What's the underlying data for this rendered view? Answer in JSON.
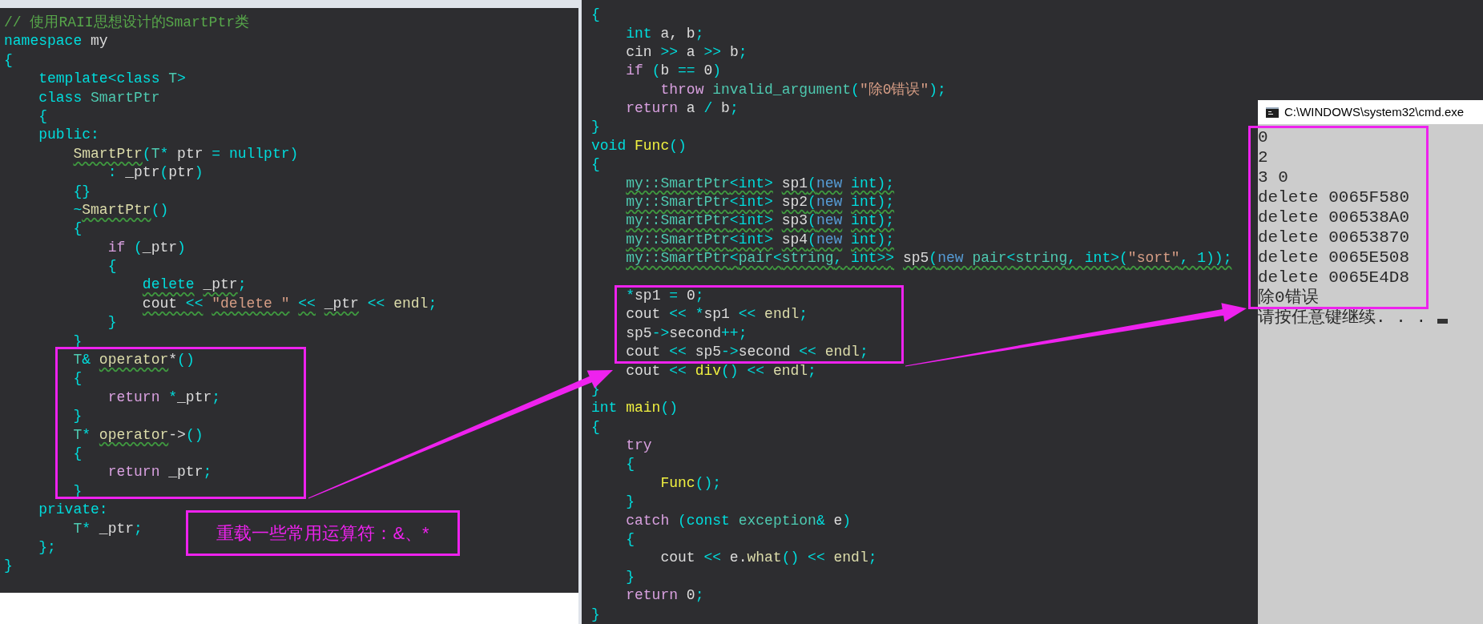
{
  "editors": [
    {
      "lines": [
        {
          "segments": [
            {
              "kind": "comment",
              "text": "// 使用RAII思想设计的SmartPtr类"
            }
          ]
        },
        {
          "segments": [
            {
              "kind": "keyword",
              "text": "namespace"
            },
            {
              "kind": "plain",
              "text": " my"
            }
          ]
        },
        {
          "segments": [
            {
              "kind": "keyword",
              "text": "{"
            }
          ]
        },
        {
          "segments": [
            {
              "kind": "keyword",
              "text": "    template<class "
            },
            {
              "kind": "type",
              "text": "T"
            },
            {
              "kind": "keyword",
              "text": ">"
            }
          ]
        },
        {
          "segments": [
            {
              "kind": "keyword",
              "text": "    class "
            },
            {
              "kind": "type",
              "text": "SmartPtr"
            }
          ]
        },
        {
          "segments": [
            {
              "kind": "keyword",
              "text": "    {"
            }
          ]
        },
        {
          "segments": [
            {
              "kind": "keyword",
              "text": "    public:"
            }
          ]
        },
        {
          "segments": [
            {
              "kind": "builtin",
              "text": "        SmartPtr",
              "squiggle": true
            },
            {
              "kind": "keyword",
              "text": "("
            },
            {
              "kind": "type",
              "text": "T"
            },
            {
              "kind": "keyword",
              "text": "* "
            },
            {
              "kind": "plain",
              "text": "ptr"
            },
            {
              "kind": "keyword",
              "text": " = nullptr)"
            }
          ]
        },
        {
          "segments": [
            {
              "kind": "keyword",
              "text": "            : "
            },
            {
              "kind": "plain",
              "text": "_ptr"
            },
            {
              "kind": "keyword",
              "text": "("
            },
            {
              "kind": "plain",
              "text": "ptr"
            },
            {
              "kind": "keyword",
              "text": ")"
            }
          ]
        },
        {
          "segments": [
            {
              "kind": "keyword",
              "text": "        {}"
            }
          ]
        },
        {
          "segments": [
            {
              "kind": "keyword",
              "text": "        ~"
            },
            {
              "kind": "builtin",
              "text": "SmartPtr",
              "squiggle": true
            },
            {
              "kind": "keyword",
              "text": "()"
            }
          ]
        },
        {
          "segments": [
            {
              "kind": "keyword",
              "text": "        {"
            }
          ]
        },
        {
          "segments": [
            {
              "kind": "control",
              "text": "            if"
            },
            {
              "kind": "keyword",
              "text": " ("
            },
            {
              "kind": "plain",
              "text": "_ptr"
            },
            {
              "kind": "keyword",
              "text": ")"
            }
          ]
        },
        {
          "segments": [
            {
              "kind": "keyword",
              "text": "            {"
            }
          ]
        },
        {
          "segments": [
            {
              "kind": "keyword",
              "text": "                delete",
              "squiggle": true
            },
            {
              "kind": "plain",
              "text": " _ptr",
              "squiggle": true
            },
            {
              "kind": "keyword",
              "text": ";"
            }
          ]
        },
        {
          "segments": [
            {
              "kind": "plain",
              "text": "                cout ",
              "squiggle": true
            },
            {
              "kind": "keyword",
              "text": "<<",
              "squiggle": true
            },
            {
              "kind": "string",
              "text": " \"delete \"",
              "squiggle": true
            },
            {
              "kind": "keyword",
              "text": " <<",
              "squiggle": true
            },
            {
              "kind": "plain",
              "text": " _ptr",
              "squiggle": true
            },
            {
              "kind": "keyword",
              "text": " <<"
            },
            {
              "kind": "builtin",
              "text": " endl"
            },
            {
              "kind": "keyword",
              "text": ";"
            }
          ]
        },
        {
          "segments": [
            {
              "kind": "keyword",
              "text": "            }"
            }
          ]
        },
        {
          "segments": [
            {
              "kind": "keyword",
              "text": "        }"
            }
          ]
        },
        {
          "segments": [
            {
              "kind": "type",
              "text": "        T"
            },
            {
              "kind": "keyword",
              "text": "& "
            },
            {
              "kind": "builtin",
              "text": "operator",
              "squiggle": true
            },
            {
              "kind": "plain",
              "text": "*"
            },
            {
              "kind": "keyword",
              "text": "()"
            }
          ]
        },
        {
          "segments": [
            {
              "kind": "keyword",
              "text": "        {"
            }
          ]
        },
        {
          "segments": [
            {
              "kind": "control",
              "text": "            return"
            },
            {
              "kind": "keyword",
              "text": " *"
            },
            {
              "kind": "plain",
              "text": "_ptr"
            },
            {
              "kind": "keyword",
              "text": ";"
            }
          ]
        },
        {
          "segments": [
            {
              "kind": "keyword",
              "text": "        }"
            }
          ]
        },
        {
          "segments": [
            {
              "kind": "type",
              "text": "        T"
            },
            {
              "kind": "keyword",
              "text": "* "
            },
            {
              "kind": "builtin",
              "text": "operator",
              "squiggle": true
            },
            {
              "kind": "plain",
              "text": "->"
            },
            {
              "kind": "keyword",
              "text": "()"
            }
          ]
        },
        {
          "segments": [
            {
              "kind": "keyword",
              "text": "        {"
            }
          ]
        },
        {
          "segments": [
            {
              "kind": "control",
              "text": "            return"
            },
            {
              "kind": "plain",
              "text": " _ptr"
            },
            {
              "kind": "keyword",
              "text": ";"
            }
          ]
        },
        {
          "segments": [
            {
              "kind": "keyword",
              "text": "        }"
            }
          ]
        },
        {
          "segments": [
            {
              "kind": "keyword",
              "text": "    private:"
            }
          ]
        },
        {
          "segments": [
            {
              "kind": "type",
              "text": "        T"
            },
            {
              "kind": "keyword",
              "text": "* "
            },
            {
              "kind": "plain",
              "text": "_ptr"
            },
            {
              "kind": "keyword",
              "text": ";"
            }
          ]
        },
        {
          "segments": [
            {
              "kind": "keyword",
              "text": "    };"
            }
          ]
        },
        {
          "segments": [
            {
              "kind": "keyword",
              "text": "}"
            }
          ]
        }
      ]
    },
    {
      "lines": [
        {
          "segments": [
            {
              "kind": "keyword",
              "text": "{"
            }
          ]
        },
        {
          "segments": [
            {
              "kind": "keyword",
              "text": "    int"
            },
            {
              "kind": "plain",
              "text": " a, b"
            },
            {
              "kind": "keyword",
              "text": ";"
            }
          ]
        },
        {
          "segments": [
            {
              "kind": "plain",
              "text": "    cin "
            },
            {
              "kind": "keyword",
              "text": ">>"
            },
            {
              "kind": "plain",
              "text": " a "
            },
            {
              "kind": "keyword",
              "text": ">>"
            },
            {
              "kind": "plain",
              "text": " b"
            },
            {
              "kind": "keyword",
              "text": ";"
            }
          ]
        },
        {
          "segments": [
            {
              "kind": "control",
              "text": "    if"
            },
            {
              "kind": "keyword",
              "text": " ("
            },
            {
              "kind": "plain",
              "text": "b "
            },
            {
              "kind": "keyword",
              "text": "=="
            },
            {
              "kind": "plain",
              "text": " 0"
            },
            {
              "kind": "keyword",
              "text": ")"
            }
          ]
        },
        {
          "segments": [
            {
              "kind": "control",
              "text": "        throw "
            },
            {
              "kind": "type",
              "text": "invalid_argument"
            },
            {
              "kind": "keyword",
              "text": "("
            },
            {
              "kind": "string",
              "text": "\"除0错误\""
            },
            {
              "kind": "keyword",
              "text": ");"
            }
          ]
        },
        {
          "segments": [
            {
              "kind": "control",
              "text": "    return"
            },
            {
              "kind": "plain",
              "text": " a "
            },
            {
              "kind": "keyword",
              "text": "/"
            },
            {
              "kind": "plain",
              "text": " b"
            },
            {
              "kind": "keyword",
              "text": ";"
            }
          ]
        },
        {
          "segments": [
            {
              "kind": "keyword",
              "text": "}"
            }
          ]
        },
        {
          "segments": [
            {
              "kind": "keyword",
              "text": "void "
            },
            {
              "kind": "function",
              "text": "Func"
            },
            {
              "kind": "keyword",
              "text": "()"
            }
          ]
        },
        {
          "segments": [
            {
              "kind": "keyword",
              "text": "{"
            }
          ]
        },
        {
          "segments": [
            {
              "kind": "type",
              "text": "    my::SmartPtr",
              "squiggle": true
            },
            {
              "kind": "keyword",
              "text": "<int>",
              "squiggle": true
            },
            {
              "kind": "plain",
              "text": " sp1",
              "squiggle": true
            },
            {
              "kind": "keyword",
              "text": "(",
              "squiggle": true
            },
            {
              "kind": "literal",
              "text": "new",
              "squiggle": true
            },
            {
              "kind": "keyword",
              "text": " int);",
              "squiggle": true
            }
          ]
        },
        {
          "segments": [
            {
              "kind": "type",
              "text": "    my::SmartPtr",
              "squiggle": true
            },
            {
              "kind": "keyword",
              "text": "<int>",
              "squiggle": true
            },
            {
              "kind": "plain",
              "text": " sp2",
              "squiggle": true
            },
            {
              "kind": "keyword",
              "text": "(",
              "squiggle": true
            },
            {
              "kind": "literal",
              "text": "new",
              "squiggle": true
            },
            {
              "kind": "keyword",
              "text": " int);",
              "squiggle": true
            }
          ]
        },
        {
          "segments": [
            {
              "kind": "type",
              "text": "    my::SmartPtr",
              "squiggle": true
            },
            {
              "kind": "keyword",
              "text": "<int>",
              "squiggle": true
            },
            {
              "kind": "plain",
              "text": " sp3",
              "squiggle": true
            },
            {
              "kind": "keyword",
              "text": "(",
              "squiggle": true
            },
            {
              "kind": "literal",
              "text": "new",
              "squiggle": true
            },
            {
              "kind": "keyword",
              "text": " int);",
              "squiggle": true
            }
          ]
        },
        {
          "segments": [
            {
              "kind": "type",
              "text": "    my::SmartPtr",
              "squiggle": true
            },
            {
              "kind": "keyword",
              "text": "<int>",
              "squiggle": true
            },
            {
              "kind": "plain",
              "text": " sp4",
              "squiggle": true
            },
            {
              "kind": "keyword",
              "text": "(",
              "squiggle": true
            },
            {
              "kind": "literal",
              "text": "new",
              "squiggle": true
            },
            {
              "kind": "keyword",
              "text": " int);",
              "squiggle": true
            }
          ]
        },
        {
          "segments": [
            {
              "kind": "type",
              "text": "    my::SmartPtr",
              "squiggle": true
            },
            {
              "kind": "keyword",
              "text": "<",
              "squiggle": true
            },
            {
              "kind": "type",
              "text": "pair",
              "squiggle": true
            },
            {
              "kind": "keyword",
              "text": "<",
              "squiggle": true
            },
            {
              "kind": "type",
              "text": "string",
              "squiggle": true
            },
            {
              "kind": "keyword",
              "text": ", int>>",
              "squiggle": true
            },
            {
              "kind": "plain",
              "text": " sp5",
              "squiggle": true
            },
            {
              "kind": "keyword",
              "text": "(",
              "squiggle": true
            },
            {
              "kind": "literal",
              "text": "new ",
              "squiggle": true
            },
            {
              "kind": "type",
              "text": "pair",
              "squiggle": true
            },
            {
              "kind": "keyword",
              "text": "<",
              "squiggle": true
            },
            {
              "kind": "type",
              "text": "string",
              "squiggle": true
            },
            {
              "kind": "keyword",
              "text": ", int>(",
              "squiggle": true
            },
            {
              "kind": "string",
              "text": "\"sort\"",
              "squiggle": true
            },
            {
              "kind": "keyword",
              "text": ", 1));",
              "squiggle": true
            }
          ],
          "blank_after": true
        },
        {
          "segments": [
            {
              "kind": "keyword",
              "text": "    *"
            },
            {
              "kind": "plain",
              "text": "sp1 "
            },
            {
              "kind": "keyword",
              "text": "="
            },
            {
              "kind": "plain",
              "text": " 0"
            },
            {
              "kind": "keyword",
              "text": ";"
            }
          ]
        },
        {
          "segments": [
            {
              "kind": "plain",
              "text": "    cout "
            },
            {
              "kind": "keyword",
              "text": "<< *"
            },
            {
              "kind": "plain",
              "text": "sp1 "
            },
            {
              "kind": "keyword",
              "text": "<<"
            },
            {
              "kind": "builtin",
              "text": " endl"
            },
            {
              "kind": "keyword",
              "text": ";"
            }
          ]
        },
        {
          "segments": [
            {
              "kind": "plain",
              "text": "    sp5"
            },
            {
              "kind": "keyword",
              "text": "->"
            },
            {
              "kind": "plain",
              "text": "second"
            },
            {
              "kind": "keyword",
              "text": "++;"
            }
          ]
        },
        {
          "segments": [
            {
              "kind": "plain",
              "text": "    cout "
            },
            {
              "kind": "keyword",
              "text": "<<"
            },
            {
              "kind": "plain",
              "text": " sp5"
            },
            {
              "kind": "keyword",
              "text": "->"
            },
            {
              "kind": "plain",
              "text": "second "
            },
            {
              "kind": "keyword",
              "text": "<<"
            },
            {
              "kind": "builtin",
              "text": " endl"
            },
            {
              "kind": "keyword",
              "text": ";"
            }
          ]
        },
        {
          "segments": [
            {
              "kind": "plain",
              "text": "    cout "
            },
            {
              "kind": "keyword",
              "text": "<< "
            },
            {
              "kind": "function",
              "text": "div"
            },
            {
              "kind": "keyword",
              "text": "() <<"
            },
            {
              "kind": "builtin",
              "text": " endl"
            },
            {
              "kind": "keyword",
              "text": ";"
            }
          ]
        },
        {
          "segments": [
            {
              "kind": "keyword",
              "text": "}"
            }
          ]
        },
        {
          "segments": [
            {
              "kind": "keyword",
              "text": "int "
            },
            {
              "kind": "function",
              "text": "main"
            },
            {
              "kind": "keyword",
              "text": "()"
            }
          ]
        },
        {
          "segments": [
            {
              "kind": "keyword",
              "text": "{"
            }
          ]
        },
        {
          "segments": [
            {
              "kind": "control",
              "text": "    try"
            }
          ]
        },
        {
          "segments": [
            {
              "kind": "keyword",
              "text": "    {"
            }
          ]
        },
        {
          "segments": [
            {
              "kind": "function",
              "text": "        Func"
            },
            {
              "kind": "keyword",
              "text": "();"
            }
          ]
        },
        {
          "segments": [
            {
              "kind": "keyword",
              "text": "    }"
            }
          ]
        },
        {
          "segments": [
            {
              "kind": "control",
              "text": "    catch"
            },
            {
              "kind": "keyword",
              "text": " (const "
            },
            {
              "kind": "type",
              "text": "exception"
            },
            {
              "kind": "keyword",
              "text": "& "
            },
            {
              "kind": "plain",
              "text": "e"
            },
            {
              "kind": "keyword",
              "text": ")"
            }
          ]
        },
        {
          "segments": [
            {
              "kind": "keyword",
              "text": "    {"
            }
          ]
        },
        {
          "segments": [
            {
              "kind": "plain",
              "text": "        cout "
            },
            {
              "kind": "keyword",
              "text": "<<"
            },
            {
              "kind": "plain",
              "text": " e."
            },
            {
              "kind": "builtin",
              "text": "what"
            },
            {
              "kind": "keyword",
              "text": "() <<"
            },
            {
              "kind": "builtin",
              "text": " endl"
            },
            {
              "kind": "keyword",
              "text": ";"
            }
          ]
        },
        {
          "segments": [
            {
              "kind": "keyword",
              "text": "    }"
            }
          ]
        },
        {
          "segments": [
            {
              "kind": "control",
              "text": "    return"
            },
            {
              "kind": "plain",
              "text": " 0"
            },
            {
              "kind": "keyword",
              "text": ";"
            }
          ]
        },
        {
          "segments": [
            {
              "kind": "keyword",
              "text": "}"
            }
          ]
        }
      ]
    }
  ],
  "callout": "重载一些常用运算符：&、*",
  "console": {
    "title": "C:\\WINDOWS\\system32\\cmd.exe",
    "lines": [
      "0",
      "2",
      "3 0",
      "delete 0065F580",
      "delete 006538A0",
      "delete 00653870",
      "delete 0065E508",
      "delete 0065E4D8",
      "除0错误",
      "请按任意键继续. . ."
    ]
  }
}
